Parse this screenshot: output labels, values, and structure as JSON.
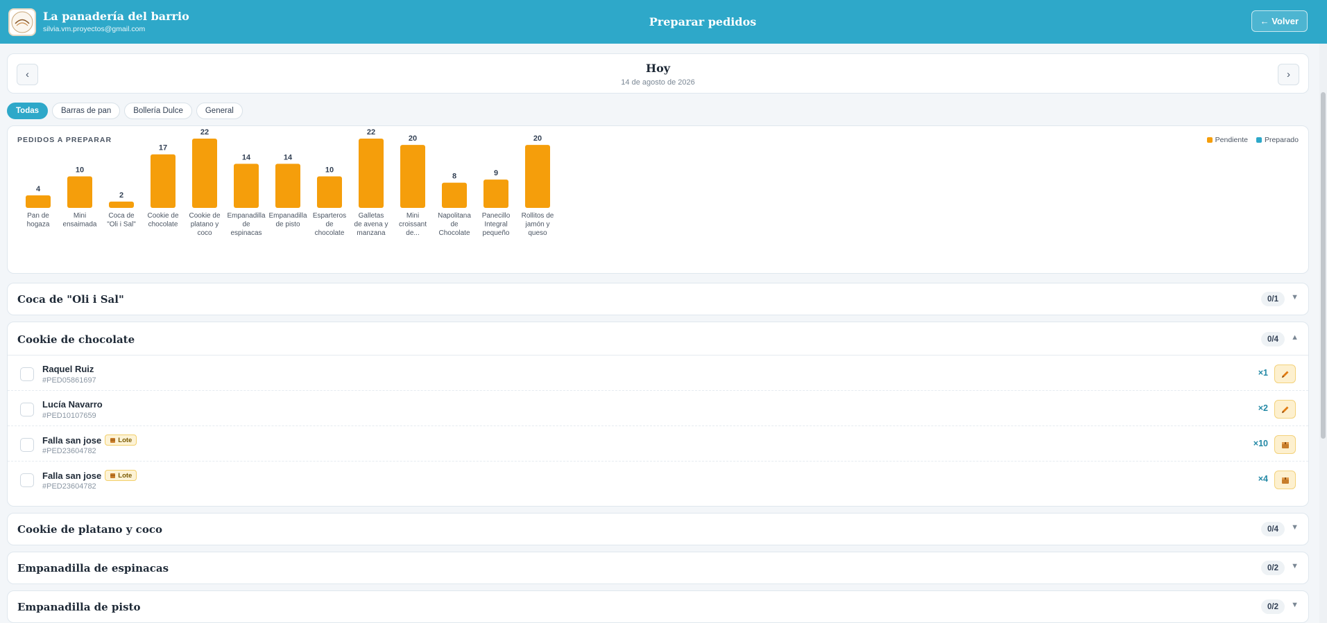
{
  "header": {
    "brand_title": "La panadería del barrio",
    "brand_email": "silvia.vm.proyectos@gmail.com",
    "page_title": "Preparar pedidos",
    "back_label": "← Volver"
  },
  "date": {
    "prev": "‹",
    "next": "›",
    "title": "Hoy",
    "subtitle": "14 de agosto de 2026"
  },
  "filters": [
    "Todas",
    "Barras de pan",
    "Bollería Dulce",
    "General"
  ],
  "chart": {
    "title": "PEDIDOS A PREPARAR",
    "legend": [
      {
        "label": "Pendiente",
        "color": "#f59e0b"
      },
      {
        "label": "Preparado",
        "color": "#2ea8c9"
      }
    ]
  },
  "chart_data": {
    "type": "bar",
    "title": "PEDIDOS A PREPARAR",
    "categories": [
      [
        "Pan de",
        "hogaza"
      ],
      [
        "Mini",
        "ensaimada"
      ],
      [
        "Coca de",
        "\"Oli i Sal\""
      ],
      [
        "Cookie de",
        "chocolate"
      ],
      [
        "Cookie de",
        "platano y",
        "coco"
      ],
      [
        "Empanadilla",
        "de",
        "espinacas"
      ],
      [
        "Empanadilla",
        "de pisto"
      ],
      [
        "Esparteros",
        "de",
        "chocolate"
      ],
      [
        "Galletas",
        "de avena y",
        "manzana"
      ],
      [
        "Mini",
        "croissant",
        "de..."
      ],
      [
        "Napolitana",
        "de",
        "Chocolate"
      ],
      [
        "Panecillo",
        "Integral",
        "pequeño"
      ],
      [
        "Rollitos de",
        "jamón y",
        "queso"
      ]
    ],
    "series": [
      {
        "name": "Pendiente",
        "color": "#f59e0b",
        "values": [
          4,
          10,
          2,
          17,
          22,
          14,
          14,
          10,
          22,
          20,
          8,
          9,
          20
        ]
      }
    ],
    "ylim": [
      0,
      22
    ]
  },
  "groups": [
    {
      "title": "Coca de \"Oli i Sal\"",
      "count": "0/1",
      "caret": "▼"
    },
    {
      "title": "Cookie de chocolate",
      "count": "0/4",
      "caret": "▲"
    },
    {
      "title": "Cookie de platano y coco",
      "count": "0/4",
      "caret": "▼"
    },
    {
      "title": "Empanadilla de espinacas",
      "count": "0/2",
      "caret": "▼"
    },
    {
      "title": "Empanadilla de pisto",
      "count": "0/2",
      "caret": "▼"
    }
  ],
  "orders": [
    {
      "name": "Raquel Ruiz",
      "id": "#PED05861697",
      "qty": "×1",
      "lote": "",
      "action_icon": "pencil-icon"
    },
    {
      "name": "Lucía Navarro",
      "id": "#PED10107659",
      "qty": "×2",
      "lote": "",
      "action_icon": "pencil-icon"
    },
    {
      "name": "Falla san jose",
      "id": "#PED23604782",
      "qty": "×10",
      "lote": "Lote",
      "action_icon": "box-icon"
    },
    {
      "name": "Falla san jose",
      "id": "#PED23604782",
      "qty": "×4",
      "lote": "Lote",
      "action_icon": "box-icon"
    }
  ]
}
